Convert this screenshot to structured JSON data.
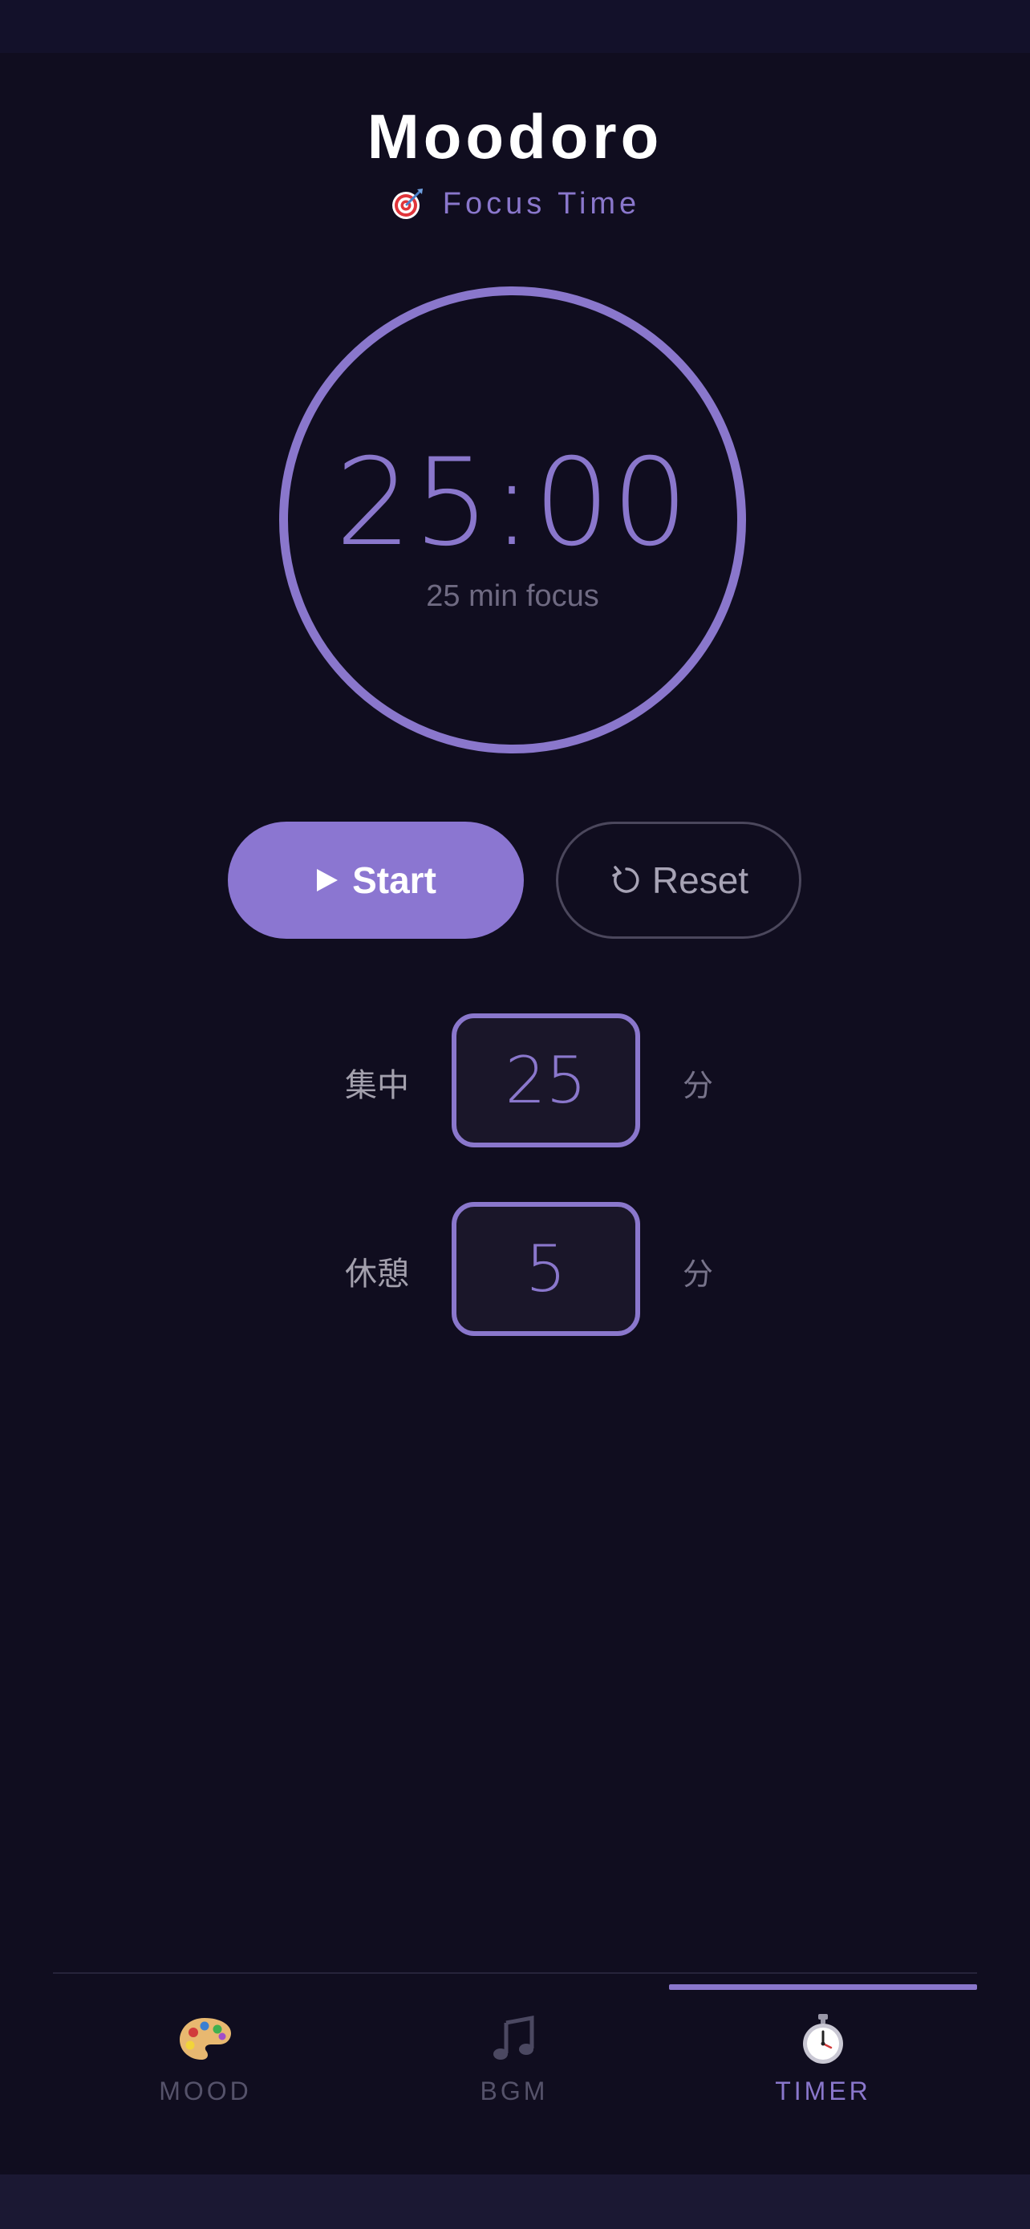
{
  "app": {
    "title": "Moodoro",
    "subtitle": "Focus Time",
    "subtitle_icon": "dart-target-icon"
  },
  "timer": {
    "display": "25:00",
    "caption": "25 min focus",
    "accent_color": "#8a77cc"
  },
  "controls": {
    "start_label": "Start",
    "reset_label": "Reset"
  },
  "settings": [
    {
      "label": "集中",
      "value": "25",
      "unit": "分"
    },
    {
      "label": "休憩",
      "value": "5",
      "unit": "分"
    }
  ],
  "tabs": [
    {
      "label": "MOOD",
      "icon": "palette-icon",
      "active": false
    },
    {
      "label": "BGM",
      "icon": "music-note-icon",
      "active": false
    },
    {
      "label": "TIMER",
      "icon": "stopwatch-icon",
      "active": true
    }
  ],
  "colors": {
    "background": "#100d1f",
    "accent": "#8a77cc",
    "start_button": "#8b76d1"
  }
}
